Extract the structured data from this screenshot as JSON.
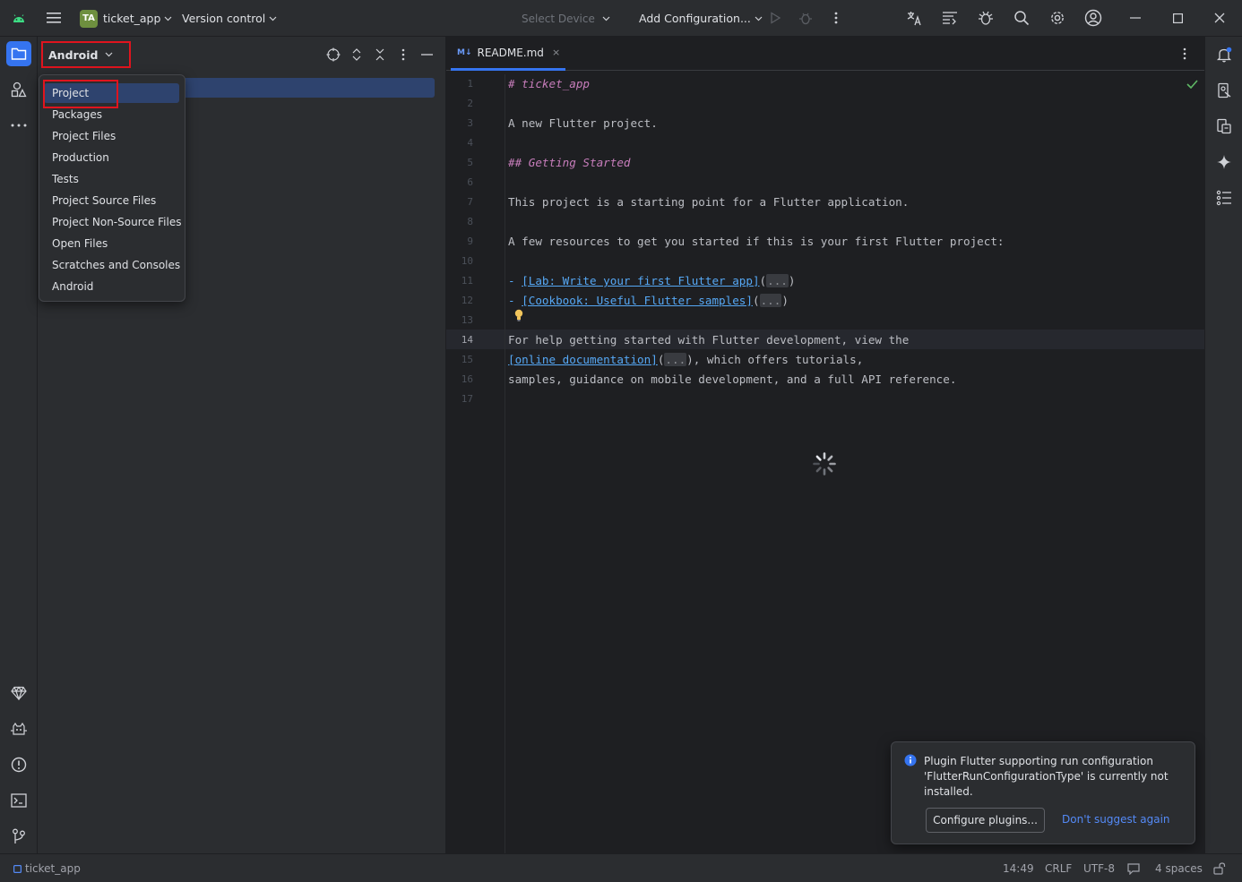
{
  "titlebar": {
    "project_initials": "TA",
    "project_name": "ticket_app",
    "vcs": "Version control",
    "device_selector": "Select Device",
    "run_config": "Add Configuration...",
    "icons": [
      "android-logo-icon",
      "hamburger-menu-icon",
      "run-icon",
      "debug-icon",
      "more-icon",
      "translate-icon",
      "ai-assistant-icon",
      "bug-icon",
      "search-icon",
      "settings-icon",
      "account-icon",
      "minimize-icon",
      "maximize-icon",
      "close-icon"
    ]
  },
  "project_panel": {
    "view_mode": "Android",
    "header_icons": [
      "locate-icon",
      "expand-all-icon",
      "collapse-all-icon",
      "more-icon",
      "hide-icon"
    ]
  },
  "view_popup": {
    "items": [
      {
        "label": "Project",
        "selected": true
      },
      {
        "label": "Packages"
      },
      {
        "label": "Project Files"
      },
      {
        "label": "Production"
      },
      {
        "label": "Tests"
      },
      {
        "label": "Project Source Files"
      },
      {
        "label": "Project Non-Source Files"
      },
      {
        "label": "Open Files"
      },
      {
        "label": "Scratches and Consoles"
      },
      {
        "label": "Android"
      }
    ]
  },
  "editor": {
    "tab": {
      "badge": "M↓",
      "label": "README.md",
      "close": "×"
    },
    "current_line": 14,
    "line_numbers": [
      "1",
      "2",
      "3",
      "4",
      "5",
      "6",
      "7",
      "8",
      "9",
      "10",
      "11",
      "12",
      "13",
      "14",
      "15",
      "16",
      "17"
    ],
    "lines": {
      "l1": "# ticket_app",
      "l3": "A new Flutter project.",
      "l5": "## Getting Started",
      "l7": "This project is a starting point for a Flutter application.",
      "l9": "A few resources to get you started if this is your first Flutter project:",
      "l11_dash": "- ",
      "l11_link": "[Lab: Write your first Flutter app]",
      "l11_open": "(",
      "l11_fold": "...",
      "l11_close": ")",
      "l12_dash": "- ",
      "l12_link": "[Cookbook: Useful Flutter samples]",
      "l12_open": "(",
      "l12_fold": "...",
      "l12_close": ")",
      "l14": "For help getting started with Flutter development, view the",
      "l15_link": "[online documentation]",
      "l15_open": "(",
      "l15_fold": "...",
      "l15_rest": "), which offers tutorials,",
      "l16": "samples, guidance on mobile development, and a full API reference."
    }
  },
  "right_strip": {
    "icons": [
      "notifications-icon",
      "device-manager-icon",
      "running-devices-icon",
      "gemini-icon",
      "structure-icon"
    ]
  },
  "left_strip": {
    "icons": [
      "project-icon",
      "resource-manager-icon",
      "more-tools-icon",
      "gradle-icon",
      "logcat-icon",
      "problems-icon",
      "terminal-icon",
      "git-icon"
    ]
  },
  "notification": {
    "message": "Plugin Flutter supporting run configuration 'FlutterRunConfigurationType' is currently not installed.",
    "primary_action": "Configure plugins...",
    "secondary_action": "Don't suggest again"
  },
  "statusbar": {
    "project": "ticket_app",
    "position": "14:49",
    "line_separator": "CRLF",
    "encoding": "UTF-8",
    "indent": "4 spaces"
  },
  "colors": {
    "accent": "#3574f0",
    "highlight_box": "#e0141e",
    "selection": "#2e436e",
    "link": "#56a8f5",
    "heading": "#c77dbb"
  }
}
